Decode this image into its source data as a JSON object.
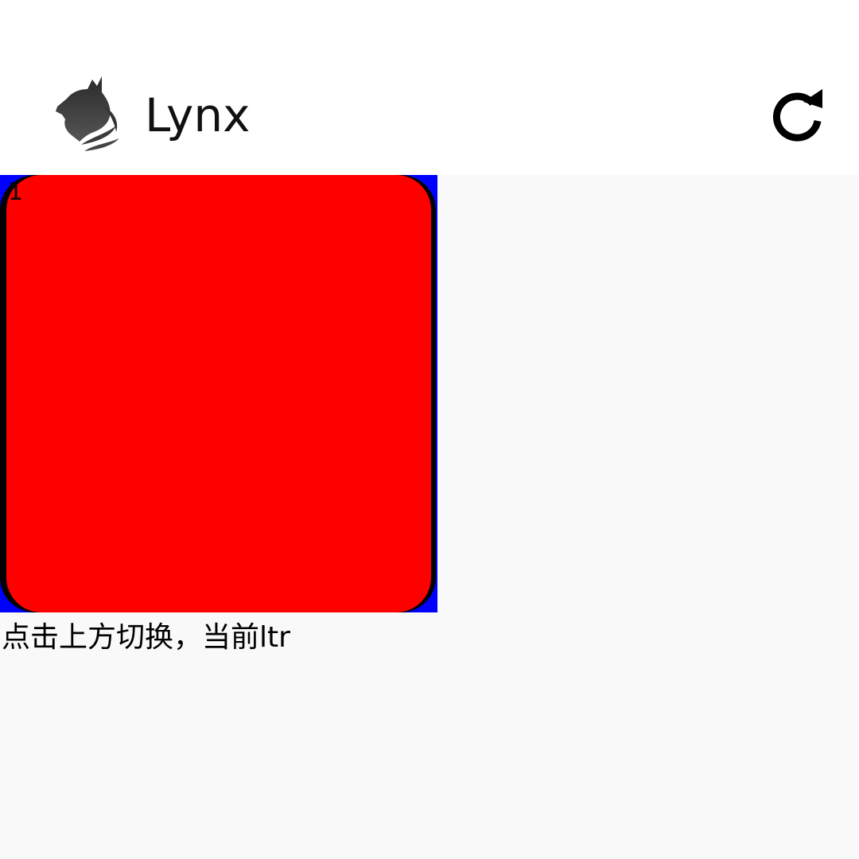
{
  "header": {
    "title": "Lynx",
    "logo_icon": "lynx-logo-icon",
    "refresh_icon": "refresh-icon"
  },
  "demo": {
    "box_number": "1",
    "box_color": "#ff0000",
    "outer_color": "#0000ff",
    "shadow_color": "#000000",
    "hint": "点击上方切换，当前ltr"
  }
}
